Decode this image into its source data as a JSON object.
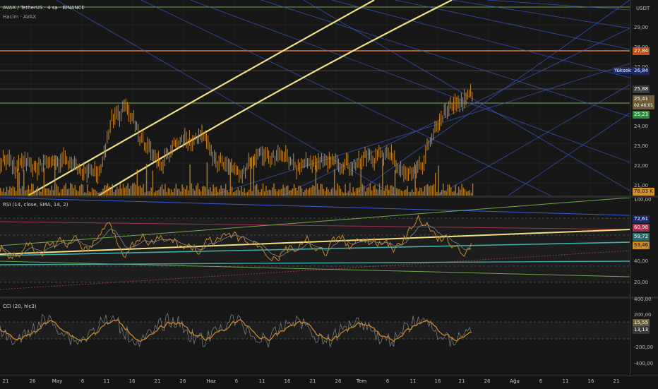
{
  "chart": {
    "title": "AVAX / TetherUS · 4 sa · BINANCE",
    "volume_label": "Hacim · AVAX",
    "currency": "USDT"
  },
  "price_axis": {
    "ticks": [
      "29,00",
      "28,00",
      "27,00",
      "24,00",
      "23,00",
      "22,00",
      "21,00"
    ],
    "badges": {
      "orange_line": "27,84",
      "high_label": "Yüksek",
      "high": "26,84",
      "upper": "25,88",
      "last": "25,41",
      "countdown": "02:46:01",
      "lower": "25,23",
      "volume": "78,03 K"
    }
  },
  "rsi": {
    "label": "RSI (14, close, SMA, 14, 2)",
    "ticks": [
      "100,00",
      "40,00",
      "20,00"
    ],
    "badges": [
      "72,61",
      "60,98",
      "59,72",
      "53,46"
    ]
  },
  "cci": {
    "label": "CCI (20, hlc3)",
    "ticks": [
      "400,00",
      "200,00",
      "-200,00",
      "-400,00"
    ],
    "badges": [
      "15,55",
      "13,13"
    ]
  },
  "time_axis": [
    "21",
    "26",
    "May",
    "6",
    "11",
    "16",
    "21",
    "26",
    "Haz",
    "6",
    "11",
    "16",
    "21",
    "26",
    "Tem",
    "6",
    "11",
    "16",
    "21",
    "26",
    "Ağu",
    "6",
    "11",
    "16",
    "21"
  ],
  "colors": {
    "background": "#171717",
    "candle": "#c8882a",
    "volume": "#d4922e",
    "orange_line": "#e07a2e",
    "yellow_line": "#f0e080",
    "blue_line": "#3b5bd6",
    "green_line": "#6fa84c",
    "last_price": "#8a7a4a",
    "lower_price": "#2d8a3e"
  }
}
